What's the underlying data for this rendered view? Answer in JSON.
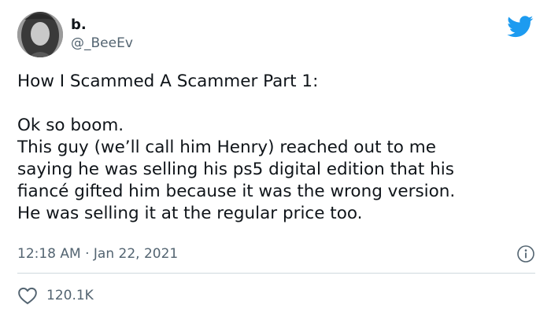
{
  "author": {
    "display_name": "b.",
    "handle": "@_BeeEv"
  },
  "tweet": {
    "title_line": "How I Scammed A Scammer Part 1:",
    "lines": [
      "Ok so boom.",
      "This guy (we’ll call him Henry) reached out to me",
      "saying he was selling his ps5 digital edition that his",
      "fiancé gifted him because it was the wrong version.",
      "He was selling it at the regular price too."
    ],
    "timestamp": "12:18 AM · Jan 22, 2021"
  },
  "engagement": {
    "likes": "120.1K"
  },
  "icons": {
    "brand": "twitter-bird-icon",
    "info": "info-icon",
    "like": "heart-icon"
  },
  "colors": {
    "brand_blue": "#1d9bf0",
    "text_primary": "#0f1419",
    "text_secondary": "#536471",
    "divider": "#cfd9de"
  }
}
